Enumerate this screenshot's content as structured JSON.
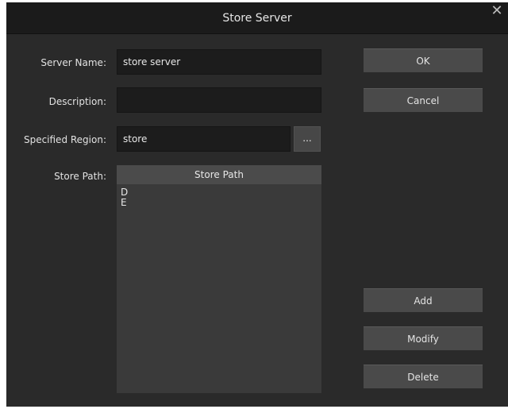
{
  "window": {
    "title": "Store Server",
    "close_glyph": "✕"
  },
  "form": {
    "server_name_label": "Server Name:",
    "server_name_value": "store server",
    "description_label": "Description:",
    "description_value": "",
    "specified_region_label": "Specified Region:",
    "specified_region_value": "store",
    "browse_label": "...",
    "store_path_label": "Store Path:"
  },
  "store_path_list": {
    "column_header": "Store Path",
    "items": [
      "D",
      "E"
    ]
  },
  "buttons": {
    "ok": "OK",
    "cancel": "Cancel",
    "add": "Add",
    "modify": "Modify",
    "delete": "Delete"
  },
  "icons": {
    "close": "close-icon"
  }
}
